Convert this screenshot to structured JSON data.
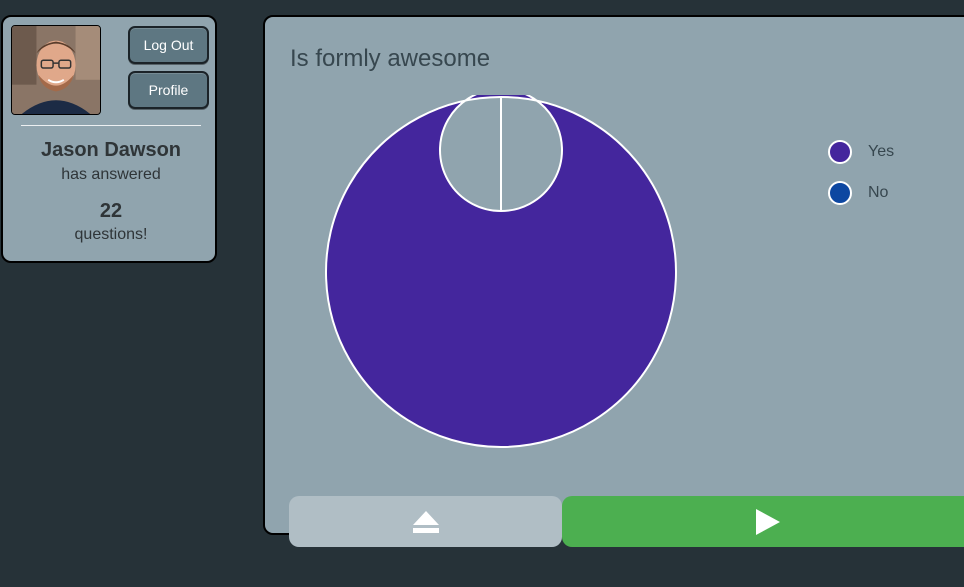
{
  "user": {
    "name": "Jason Dawson",
    "answered_label": "has answered",
    "count": "22",
    "questions_label": "questions!"
  },
  "buttons": {
    "logout": "Log Out",
    "profile": "Profile"
  },
  "question": {
    "title": "Is formly awesome"
  },
  "chart_data": {
    "type": "pie",
    "categories": [
      "Yes",
      "No"
    ],
    "values": [
      1,
      0
    ],
    "colors": [
      "#44269d",
      "#0d47a1"
    ],
    "legend_position": "right"
  },
  "nav": {
    "back_icon": "eject-icon",
    "next_icon": "play-icon"
  }
}
